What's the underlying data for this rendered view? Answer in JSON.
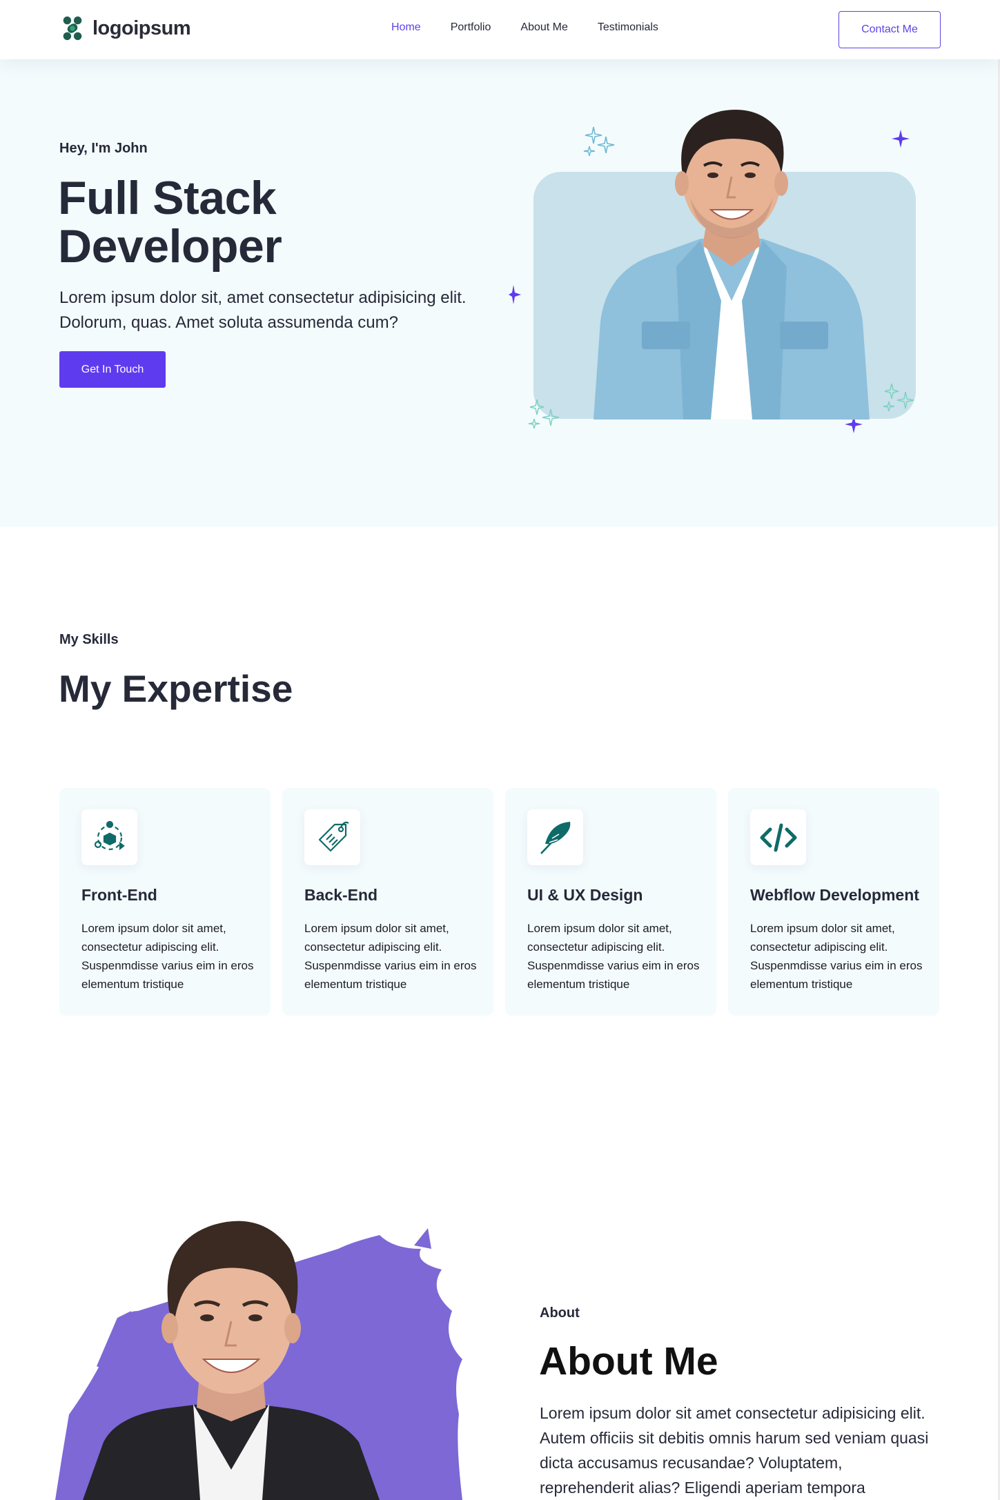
{
  "nav": {
    "logo_text": "logoipsum",
    "links": [
      {
        "label": "Home",
        "active": true
      },
      {
        "label": "Portfolio",
        "active": false
      },
      {
        "label": "About Me",
        "active": false
      },
      {
        "label": "Testimonials",
        "active": false
      }
    ],
    "contact_label": "Contact Me"
  },
  "hero": {
    "kicker": "Hey, I'm John",
    "title": "Full Stack Developer",
    "description": "Lorem ipsum dolor sit, amet consectetur adipisicing elit. Dolorum, quas. Amet soluta assumenda cum?",
    "cta_label": "Get In Touch"
  },
  "skills": {
    "kicker": "My Skills",
    "title": "My Expertise",
    "cards": [
      {
        "icon": "frontend-icon",
        "title": "Front-End",
        "text": "Lorem ipsum dolor sit amet, consectetur adipiscing elit. Suspenmdisse varius eim in eros elementum tristique"
      },
      {
        "icon": "backend-tag-icon",
        "title": "Back-End",
        "text": "Lorem ipsum dolor sit amet, consectetur adipiscing elit. Suspenmdisse varius eim in eros elementum tristique"
      },
      {
        "icon": "feather-icon",
        "title": "UI & UX Design",
        "text": "Lorem ipsum dolor sit amet, consectetur adipiscing elit. Suspenmdisse varius eim in eros elementum tristique"
      },
      {
        "icon": "code-icon",
        "title": "Webflow Development",
        "text": "Lorem ipsum dolor sit amet, consectetur adipiscing elit. Suspenmdisse varius eim in eros elementum tristique"
      }
    ]
  },
  "about": {
    "kicker": "About",
    "title": "About Me",
    "text": "Lorem ipsum dolor sit amet consectetur adipisicing elit. Autem officiis sit debitis omnis harum sed veniam quasi dicta accusamus recusandae? Voluptatem, reprehenderit alias? Eligendi aperiam tempora"
  },
  "colors": {
    "accent": "#5f42e8",
    "heading": "#262938",
    "hero_bg": "#f4fbfd",
    "icon_teal": "#0e6b68",
    "about_splash": "#7d68d6"
  }
}
